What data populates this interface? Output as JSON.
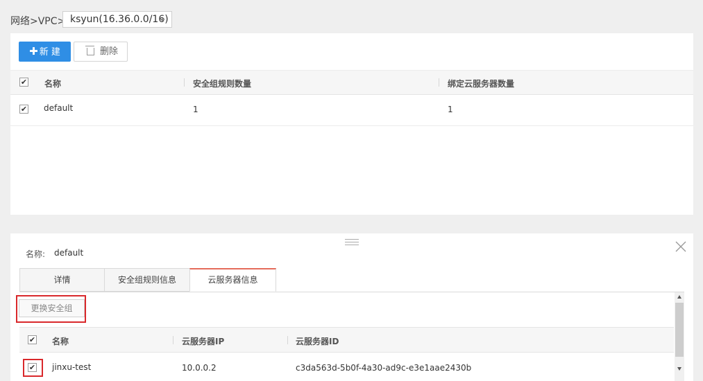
{
  "breadcrumb": {
    "path": "网络>VPC>",
    "vpc_selected": "ksyun(16.36.0.0/16)"
  },
  "toolbar": {
    "new_label": "新 建",
    "delete_label": "删除"
  },
  "security_groups": {
    "columns": [
      "名称",
      "安全组规则数量",
      "绑定云服务器数量"
    ],
    "rows": [
      {
        "name": "default",
        "rule_count": "1",
        "server_count": "1"
      }
    ]
  },
  "detail": {
    "name_label": "名称:",
    "name_value": "default",
    "tabs": [
      "详情",
      "安全组规则信息",
      "云服务器信息"
    ],
    "active_tab": "云服务器信息",
    "change_button": "更换安全组",
    "columns": [
      "名称",
      "云服务器IP",
      "云服务器ID"
    ],
    "rows": [
      {
        "name": "jinxu-test",
        "ip": "10.0.0.2",
        "id": "c3da563d-5b0f-4a30-ad9c-e3e1aae2430b"
      }
    ]
  },
  "colors": {
    "primary": "#2f8ee5",
    "highlight": "#d9282b",
    "active_tab_accent": "#e56b5a"
  }
}
